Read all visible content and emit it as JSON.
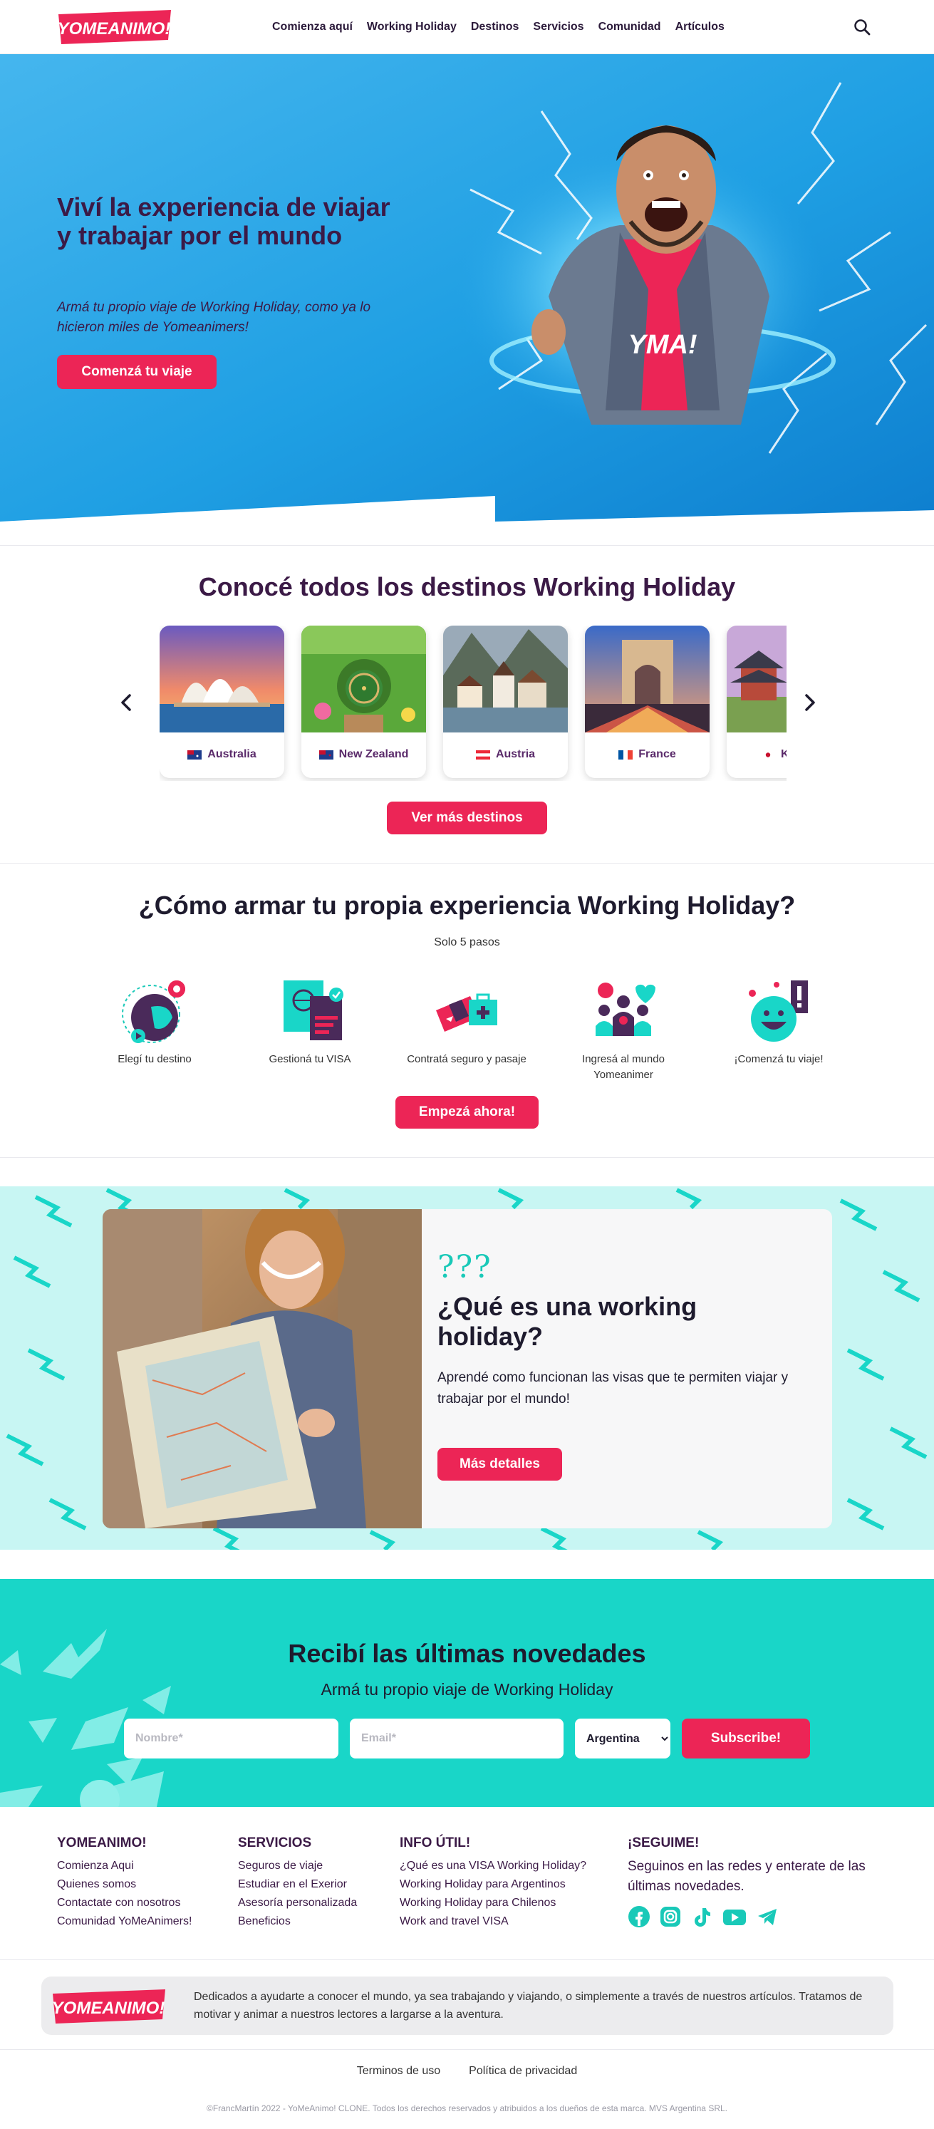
{
  "colors": {
    "brand_pink": "#ec2556",
    "brand_purple": "#3b1a46",
    "teal": "#19d6c8",
    "light_teal": "#c8f6f3",
    "hero_blue": "#2aa8e8"
  },
  "nav": {
    "logo_text": "YOMEANIMO!",
    "links": [
      "Comienza aquí",
      "Working Holiday",
      "Destinos",
      "Servicios",
      "Comunidad",
      "Artículos"
    ],
    "search_icon": "search-icon"
  },
  "hero": {
    "title": "Viví la experiencia de viajar y trabajar por el mundo",
    "subtitle": "Armá tu propio viaje de Working Holiday, como ya lo hicieron miles de Yomeanimers!",
    "cta": "Comenzá tu viaje",
    "shirt_text": "YMA!"
  },
  "destinations": {
    "title": "Conocé todos los destinos Working Holiday",
    "cards": [
      {
        "name": "Australia",
        "flag": "australia-flag"
      },
      {
        "name": "New Zealand",
        "flag": "new-zealand-flag"
      },
      {
        "name": "Austria",
        "flag": "austria-flag"
      },
      {
        "name": "France",
        "flag": "france-flag"
      },
      {
        "name": "K",
        "flag": "korea-flag"
      }
    ],
    "prev_icon": "chevron-left-icon",
    "next_icon": "chevron-right-icon",
    "cta": "Ver más destinos"
  },
  "steps": {
    "title": "¿Cómo armar tu propia experiencia Working Holiday?",
    "subtitle": "Solo 5 pasos",
    "items": [
      {
        "label": "Elegí tu destino",
        "icon": "destination-icon"
      },
      {
        "label": "Gestioná tu VISA",
        "icon": "passport-icon"
      },
      {
        "label": "Contratá seguro y pasaje",
        "icon": "ticket-insurance-icon"
      },
      {
        "label": "Ingresá al mundo Yomeanimer",
        "icon": "community-icon"
      },
      {
        "label": "¡Comenzá tu viaje!",
        "icon": "smiley-icon"
      }
    ],
    "cta": "Empezá ahora!"
  },
  "whatis": {
    "question_marks": "???",
    "title": "¿Qué es una working holiday?",
    "text": "Aprendé como funcionan las visas que te permiten viajar y trabajar por el mundo!",
    "cta": "Más detalles"
  },
  "newsletter": {
    "title": "Recibí las últimas novedades",
    "subtitle": "Armá tu propio viaje de Working Holiday",
    "name_placeholder": "Nombre*",
    "email_placeholder": "Email*",
    "country": "Argentina",
    "cta": "Subscribe!"
  },
  "footer": {
    "col1": {
      "title": "YOMEANIMO!",
      "links": [
        "Comienza Aqui",
        "Quienes somos",
        "Contactate con nosotros",
        "Comunidad YoMeAnimers!"
      ]
    },
    "col2": {
      "title": "SERVICIOS",
      "links": [
        "Seguros de viaje",
        "Estudiar en el Exerior",
        "Asesoría personalizada",
        "Beneficios"
      ]
    },
    "col3": {
      "title": "INFO ÚTIL!",
      "links": [
        "¿Qué es una VISA Working Holiday?",
        "Working Holiday para Argentinos",
        "Working Holiday para Chilenos",
        "Work and travel VISA"
      ]
    },
    "col4": {
      "title": "¡SEGUIME!",
      "text": "Seguinos en las redes y enterate de las últimas novedades."
    },
    "social": [
      "facebook-icon",
      "instagram-icon",
      "tiktok-icon",
      "youtube-icon",
      "telegram-icon"
    ],
    "about": "Dedicados a ayudarte a conocer el mundo, ya sea trabajando y viajando, o simplemente a través de nuestros artículos. Tratamos de motivar y animar a nuestros lectores a largarse a la aventura.",
    "legal": [
      "Terminos de uso",
      "Política de privacidad"
    ],
    "copyright": "©FrancMartín 2022 - YoMeAnimo! CLONE. Todos los derechos reservados y atribuidos a los dueños de esta marca. MVS Argentina SRL."
  }
}
